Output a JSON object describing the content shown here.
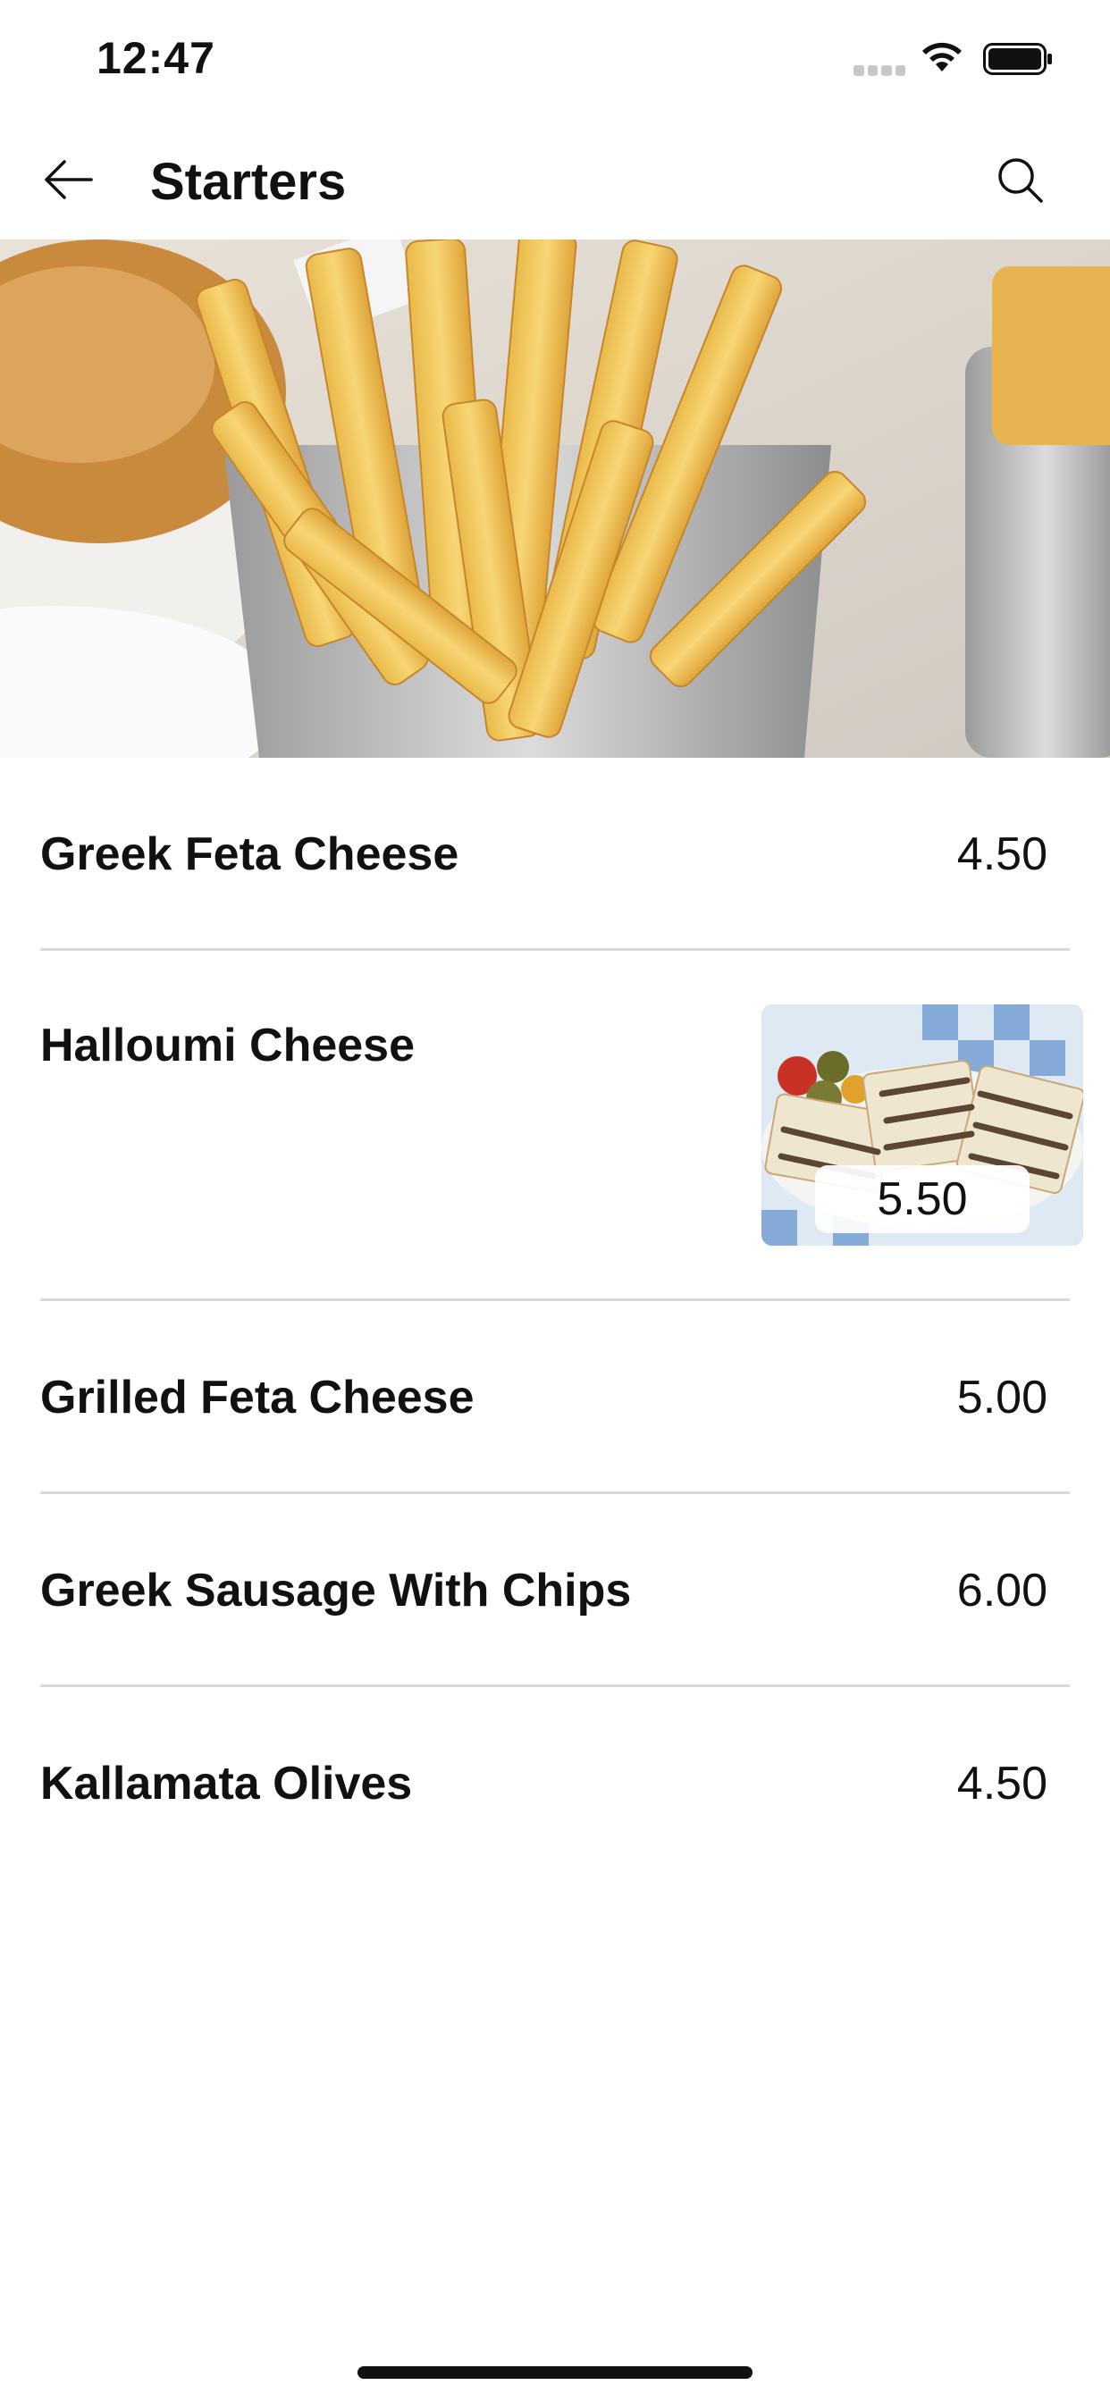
{
  "status_bar": {
    "time": "12:47",
    "icons": [
      "signal-icon",
      "wifi-icon",
      "battery-icon"
    ]
  },
  "header": {
    "title": "Starters",
    "back_icon": "arrow-left-icon",
    "search_icon": "search-icon"
  },
  "hero": {
    "image": "fries-photo"
  },
  "menu_items": [
    {
      "name": "Greek Feta Cheese",
      "price": "4.50"
    },
    {
      "name": "Halloumi Cheese",
      "price": "5.50",
      "image": "halloumi-photo"
    },
    {
      "name": "Grilled Feta Cheese",
      "price": "5.00"
    },
    {
      "name": "Greek Sausage With Chips",
      "price": "6.00"
    },
    {
      "name": "Kallamata Olives",
      "price": "4.50"
    }
  ],
  "colors": {
    "text": "#111111",
    "divider": "#d8d8d8",
    "background": "#ffffff"
  }
}
